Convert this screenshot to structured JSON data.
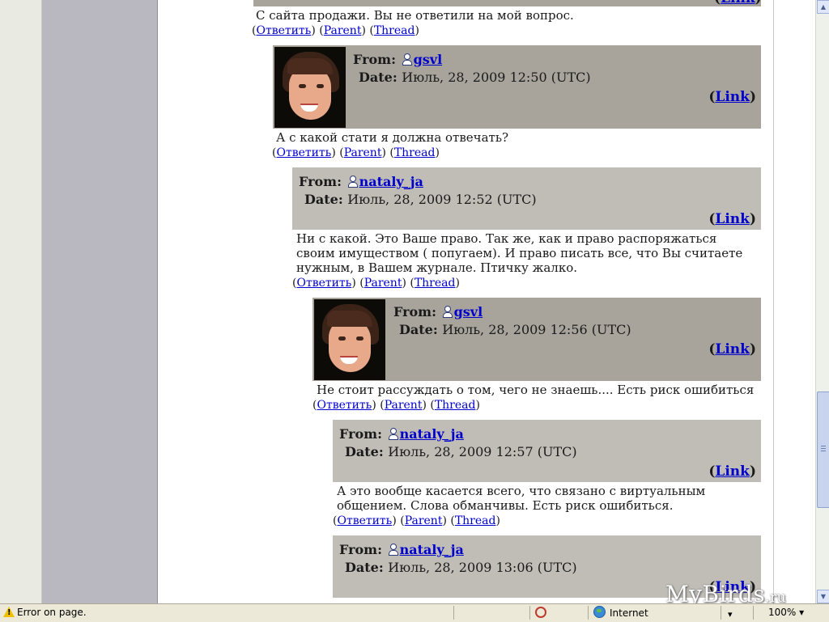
{
  "top_comment": {
    "text": "С сайта продажи. Вы не ответили на мой вопрос.",
    "actions": {
      "reply": "Ответить",
      "parent": "Parent",
      "thread": "Thread"
    }
  },
  "labels": {
    "from": "From:",
    "date": "Date:",
    "link": "Link"
  },
  "comments": [
    {
      "user": "gsvl",
      "date": "Июль, 28, 2009 12:50 (UTC)",
      "text": "А с какой стати я должна отвечать?",
      "has_avatar": true
    },
    {
      "user": "nataly_ja",
      "date": "Июль, 28, 2009 12:52 (UTC)",
      "text": "Ни с какой. Это Ваше право. Так же, как и право распоряжаться своим имуществом ( попугаем). И право писать все, что Вы считаете нужным, в Вашем журнале. Птичку жалко.",
      "has_avatar": false
    },
    {
      "user": "gsvl",
      "date": "Июль, 28, 2009 12:56 (UTC)",
      "text": "Не стоит рассуждать о том, чего не знаешь.... Есть риск ошибиться",
      "has_avatar": true
    },
    {
      "user": "nataly_ja",
      "date": "Июль, 28, 2009 12:57 (UTC)",
      "text": "А это вообще касается всего, что связано с виртуальным общением. Слова обманчивы. Есть риск ошибиться.",
      "has_avatar": false
    },
    {
      "user": "nataly_ja",
      "date": "Июль, 28, 2009 13:06 (UTC)",
      "text": "",
      "has_avatar": false
    }
  ],
  "actions": {
    "reply": "Ответить",
    "parent": "Parent",
    "thread": "Thread"
  },
  "statusbar": {
    "message": "Error on page.",
    "zone": "Internet",
    "zoom": "100%"
  },
  "watermark": {
    "main": "MyBirds",
    "tld": ".ru"
  },
  "colors": {
    "header_dark": "#a8a49c",
    "header_light": "#c0bdb7",
    "link": "#0000cc"
  }
}
